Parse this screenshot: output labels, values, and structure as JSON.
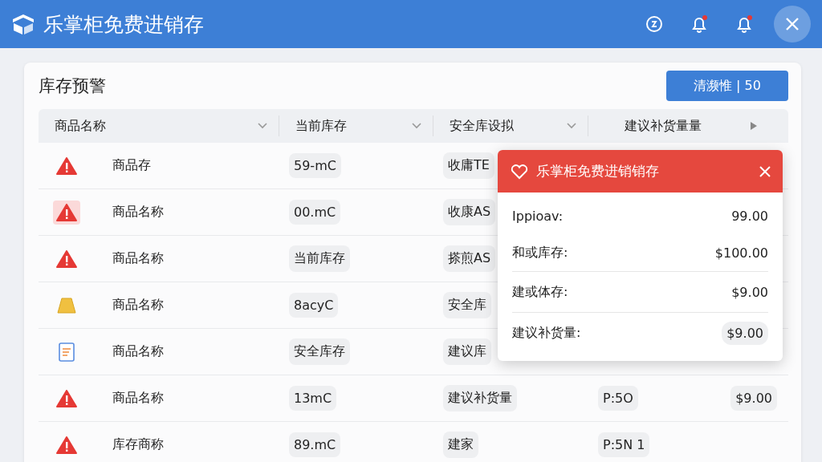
{
  "app_bar": {
    "title": "乐掌柜免费进销存"
  },
  "panel": {
    "title": "库存预警",
    "action_button": "清濒惟 | 50"
  },
  "table": {
    "columns": [
      "商品名称",
      "当前库存",
      "安全库设拟",
      "建议补货量量"
    ],
    "rows": [
      {
        "kind": "alert",
        "highlighted": false,
        "name": "商品存",
        "stock": "59-mC",
        "safety": "收庸TE"
      },
      {
        "kind": "alert",
        "highlighted": true,
        "name": "商品名称",
        "stock": "00.mC",
        "safety": "收康AS"
      },
      {
        "kind": "alert",
        "highlighted": false,
        "name": "商品名称",
        "stock": "当前库存",
        "safety": "搽煎AS"
      },
      {
        "kind": "ingot",
        "highlighted": false,
        "name": "商品名称",
        "stock": "8acyC",
        "safety": "安全库"
      },
      {
        "kind": "note",
        "highlighted": false,
        "name": "商品名称",
        "stock": "安全库存",
        "safety": "建议库"
      },
      {
        "kind": "alert",
        "highlighted": false,
        "name": "商品名称",
        "stock": "13mC",
        "safety": "建议补货量",
        "column_4": "P:5O",
        "column_5": "$9.00"
      },
      {
        "kind": "alert",
        "highlighted": false,
        "name": "库存商称",
        "stock": "89.mC",
        "safety": "建家",
        "column_4": "P:5N 1"
      }
    ]
  },
  "popup": {
    "title": "乐掌柜免费进销销存",
    "rows": [
      {
        "label": "Ippioav:",
        "value": "99.00",
        "divider": false,
        "pill": false
      },
      {
        "label": "和或库存:",
        "value": "$100.00",
        "divider": false,
        "pill": false
      },
      {
        "label": "建或体存:",
        "value": "$9.00",
        "divider": true,
        "pill": false
      },
      {
        "label": "建议补货量:",
        "value": "$9.00",
        "divider": true,
        "pill": true
      }
    ]
  }
}
